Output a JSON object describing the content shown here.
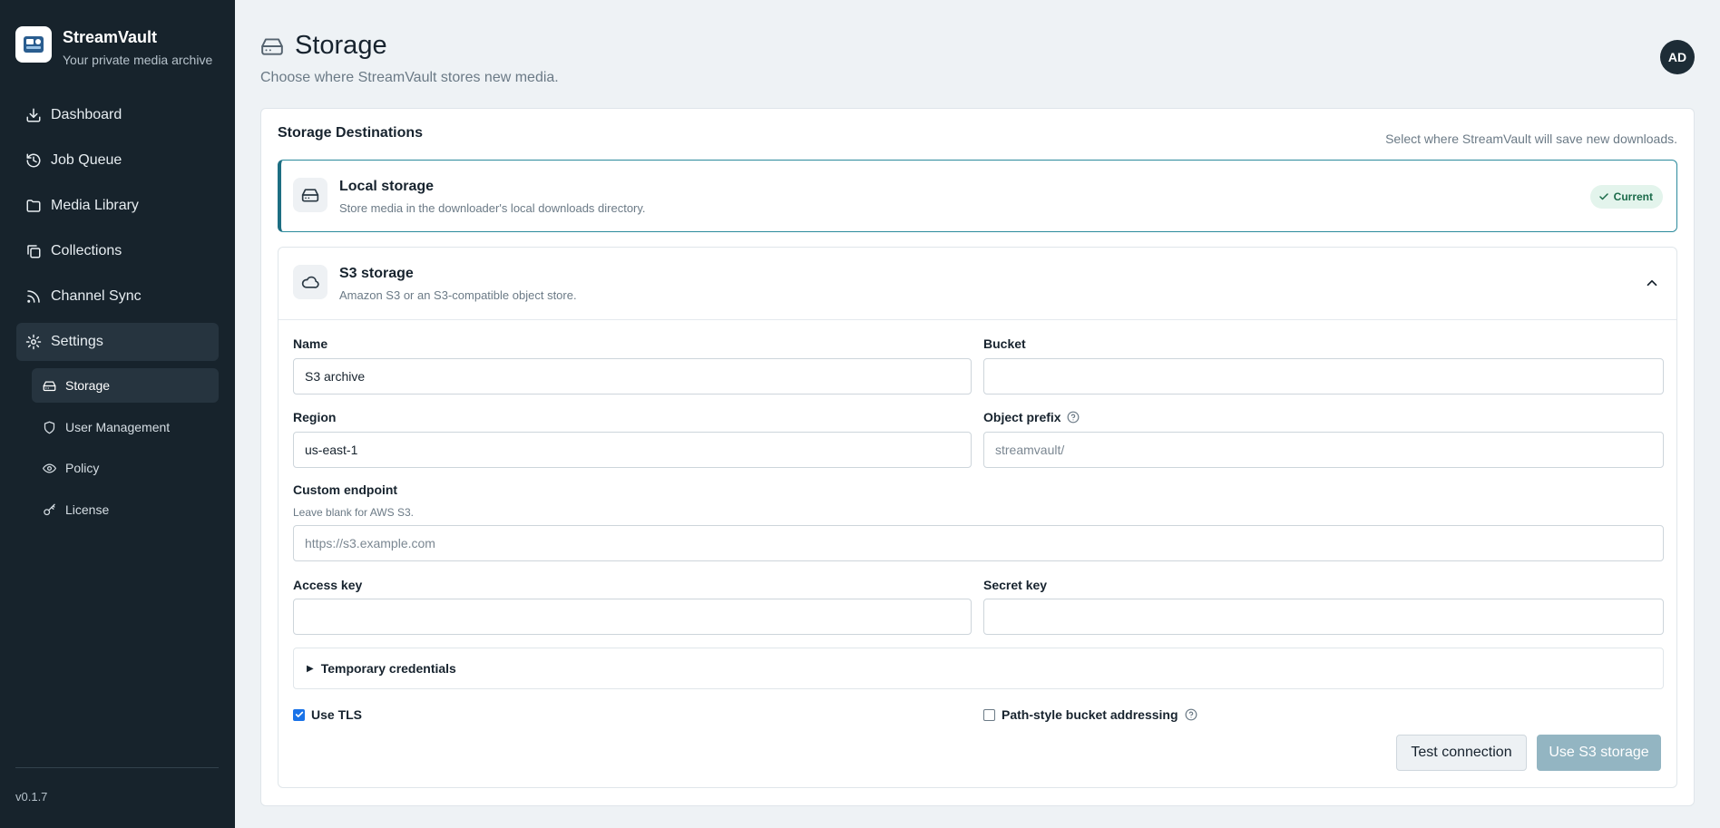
{
  "brand": {
    "name": "StreamVault",
    "tagline": "Your private media archive"
  },
  "nav": [
    {
      "label": "Dashboard",
      "icon": "download-icon"
    },
    {
      "label": "Job Queue",
      "icon": "history-icon"
    },
    {
      "label": "Media Library",
      "icon": "folder-icon"
    },
    {
      "label": "Collections",
      "icon": "collections-icon"
    },
    {
      "label": "Channel Sync",
      "icon": "rss-icon"
    },
    {
      "label": "Settings",
      "icon": "gear-icon",
      "active": true
    }
  ],
  "subnav": [
    {
      "label": "Storage",
      "icon": "storage-icon",
      "active": true
    },
    {
      "label": "User Management",
      "icon": "shield-icon"
    },
    {
      "label": "Policy",
      "icon": "eye-icon"
    },
    {
      "label": "License",
      "icon": "key-icon"
    }
  ],
  "version": "v0.1.7",
  "header": {
    "title": "Storage",
    "subtitle": "Choose where StreamVault stores new media.",
    "avatar": "AD"
  },
  "card": {
    "title": "Storage Destinations",
    "hint": "Select where StreamVault will save new downloads.",
    "local": {
      "name": "Local storage",
      "description": "Store media in the downloader's local downloads directory.",
      "badge": "Current"
    },
    "s3": {
      "name": "S3 storage",
      "description": "Amazon S3 or an S3-compatible object store.",
      "fields": {
        "name": {
          "label": "Name",
          "value": "S3 archive",
          "placeholder": ""
        },
        "bucket": {
          "label": "Bucket",
          "value": "",
          "placeholder": ""
        },
        "region": {
          "label": "Region",
          "value": "us-east-1",
          "placeholder": ""
        },
        "prefix": {
          "label": "Object prefix",
          "value": "",
          "placeholder": "streamvault/"
        },
        "endpoint": {
          "label": "Custom endpoint",
          "help": "Leave blank for AWS S3.",
          "value": "",
          "placeholder": "https://s3.example.com"
        },
        "access_key": {
          "label": "Access key",
          "value": "",
          "placeholder": ""
        },
        "secret_key": {
          "label": "Secret key",
          "value": "",
          "placeholder": ""
        }
      },
      "temp_credentials": "Temporary credentials",
      "use_tls": {
        "label": "Use TLS",
        "checked": true
      },
      "path_style": {
        "label": "Path-style bucket addressing",
        "checked": false
      },
      "test_button": "Test connection",
      "use_button": "Use S3 storage"
    }
  },
  "colors": {
    "sidebar": "#17232c",
    "accent": "#1d6e82",
    "primary_button": "#93b5c2",
    "badge_bg": "#e3f4ec",
    "badge_text": "#1b6b4a"
  }
}
